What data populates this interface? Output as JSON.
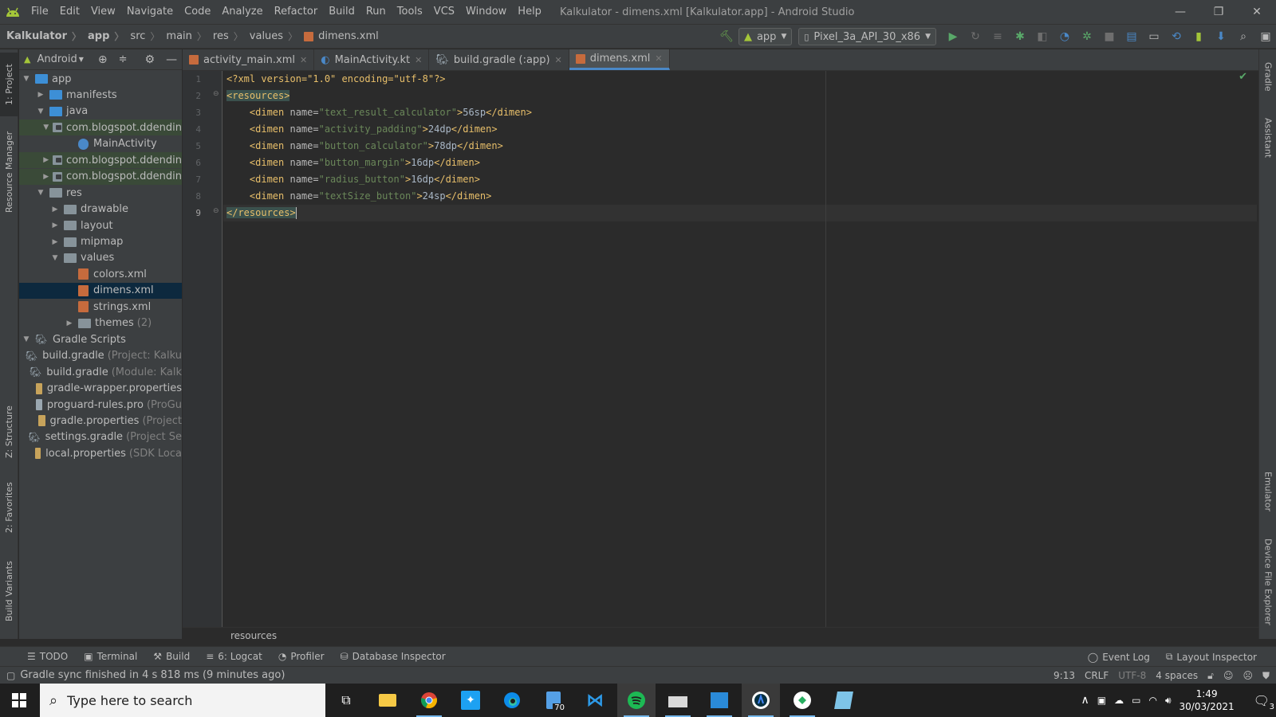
{
  "window": {
    "title": "Kalkulator - dimens.xml [Kalkulator.app] - Android Studio",
    "controls": [
      "—",
      "❐",
      "✕"
    ]
  },
  "menu": [
    "File",
    "Edit",
    "View",
    "Navigate",
    "Code",
    "Analyze",
    "Refactor",
    "Build",
    "Run",
    "Tools",
    "VCS",
    "Window",
    "Help"
  ],
  "breadcrumb": [
    "Kalkulator",
    "app",
    "src",
    "main",
    "res",
    "values",
    "dimens.xml"
  ],
  "toolbar": {
    "config": "app",
    "device": "Pixel_3a_API_30_x86"
  },
  "project_panel": {
    "view_mode": "Android",
    "tree": [
      {
        "label": "app",
        "extra": "",
        "depth": 0,
        "arrow": "down",
        "icon": "folder-blue"
      },
      {
        "label": "manifests",
        "extra": "",
        "depth": 1,
        "arrow": "right",
        "icon": "folder-blue"
      },
      {
        "label": "java",
        "extra": "",
        "depth": 1,
        "arrow": "down",
        "icon": "folder-blue"
      },
      {
        "label": "com.blogspot.ddendin",
        "extra": "",
        "depth": 2,
        "arrow": "down",
        "icon": "package"
      },
      {
        "label": "MainActivity",
        "extra": "",
        "depth": 3,
        "arrow": "",
        "icon": "kotlin"
      },
      {
        "label": "com.blogspot.ddendin",
        "extra": "",
        "depth": 2,
        "arrow": "right",
        "icon": "package"
      },
      {
        "label": "com.blogspot.ddendin",
        "extra": "",
        "depth": 2,
        "arrow": "right",
        "icon": "package"
      },
      {
        "label": "res",
        "extra": "",
        "depth": 1,
        "arrow": "down",
        "icon": "folder-res"
      },
      {
        "label": "drawable",
        "extra": "",
        "depth": 2,
        "arrow": "right",
        "icon": "folder"
      },
      {
        "label": "layout",
        "extra": "",
        "depth": 2,
        "arrow": "right",
        "icon": "folder"
      },
      {
        "label": "mipmap",
        "extra": "",
        "depth": 2,
        "arrow": "right",
        "icon": "folder"
      },
      {
        "label": "values",
        "extra": "",
        "depth": 2,
        "arrow": "down",
        "icon": "folder"
      },
      {
        "label": "colors.xml",
        "extra": "",
        "depth": 3,
        "arrow": "",
        "icon": "xml"
      },
      {
        "label": "dimens.xml",
        "extra": "",
        "depth": 3,
        "arrow": "",
        "icon": "xml",
        "selected": true
      },
      {
        "label": "strings.xml",
        "extra": "",
        "depth": 3,
        "arrow": "",
        "icon": "xml"
      },
      {
        "label": "themes",
        "extra": "(2)",
        "depth": 3,
        "arrow": "right",
        "icon": "folder"
      },
      {
        "label": "Gradle Scripts",
        "extra": "",
        "depth": 0,
        "arrow": "down",
        "icon": "gradle"
      },
      {
        "label": "build.gradle",
        "extra": "(Project: Kalku",
        "depth": 1,
        "arrow": "",
        "icon": "gradle"
      },
      {
        "label": "build.gradle",
        "extra": "(Module: Kalk",
        "depth": 1,
        "arrow": "",
        "icon": "gradle"
      },
      {
        "label": "gradle-wrapper.properties",
        "extra": "",
        "depth": 1,
        "arrow": "",
        "icon": "props"
      },
      {
        "label": "proguard-rules.pro",
        "extra": "(ProGu",
        "depth": 1,
        "arrow": "",
        "icon": "file"
      },
      {
        "label": "gradle.properties",
        "extra": "(Project",
        "depth": 1,
        "arrow": "",
        "icon": "props"
      },
      {
        "label": "settings.gradle",
        "extra": "(Project Se",
        "depth": 1,
        "arrow": "",
        "icon": "gradle"
      },
      {
        "label": "local.properties",
        "extra": "(SDK Loca",
        "depth": 1,
        "arrow": "",
        "icon": "props"
      }
    ]
  },
  "left_tool_tabs": [
    "1: Project",
    "Resource Manager",
    "Z: Structure",
    "2: Favorites",
    "Build Variants"
  ],
  "right_tool_tabs": [
    "Gradle",
    "Assistant",
    "Emulator",
    "Device File Explorer"
  ],
  "editor_tabs": [
    {
      "label": "activity_main.xml",
      "active": false
    },
    {
      "label": "MainActivity.kt",
      "active": false
    },
    {
      "label": "build.gradle (:app)",
      "active": false
    },
    {
      "label": "dimens.xml",
      "active": true
    }
  ],
  "code": {
    "line_numbers": [
      "1",
      "2",
      "3",
      "4",
      "5",
      "6",
      "7",
      "8",
      "9"
    ],
    "xml_decl": "<?xml version=\"1.0\" encoding=\"utf-8\"?>",
    "open_tag": "<resources>",
    "close_tag": "</resources>",
    "dimens": [
      {
        "name": "\"text_result_calculator\"",
        "value": "56sp"
      },
      {
        "name": "\"activity_padding\"",
        "value": "24dp"
      },
      {
        "name": "\"button_calculator\"",
        "value": "78dp"
      },
      {
        "name": "\"button_margin\"",
        "value": "16dp"
      },
      {
        "name": "\"radius_button\"",
        "value": "16dp"
      },
      {
        "name": "\"textSize_button\"",
        "value": "24sp"
      }
    ],
    "breadcrumb_footer": "resources"
  },
  "bottom_tools": [
    "TODO",
    "Terminal",
    "Build",
    "6: Logcat",
    "Profiler",
    "Database Inspector"
  ],
  "bottom_tools_right": [
    "Event Log",
    "Layout Inspector"
  ],
  "status": {
    "message": "Gradle sync finished in 4 s 818 ms (9 minutes ago)",
    "position": "9:13",
    "line_sep": "CRLF",
    "encoding": "UTF-8",
    "indent": "4 spaces"
  },
  "taskbar": {
    "search_placeholder": "Type here to search",
    "time": "1:49",
    "date": "30/03/2021",
    "files_badge": "70",
    "notif_count": "3"
  },
  "colors": {
    "android_green": "#a4c639",
    "accent_blue": "#4a88c7",
    "spotify": "#1db954"
  }
}
